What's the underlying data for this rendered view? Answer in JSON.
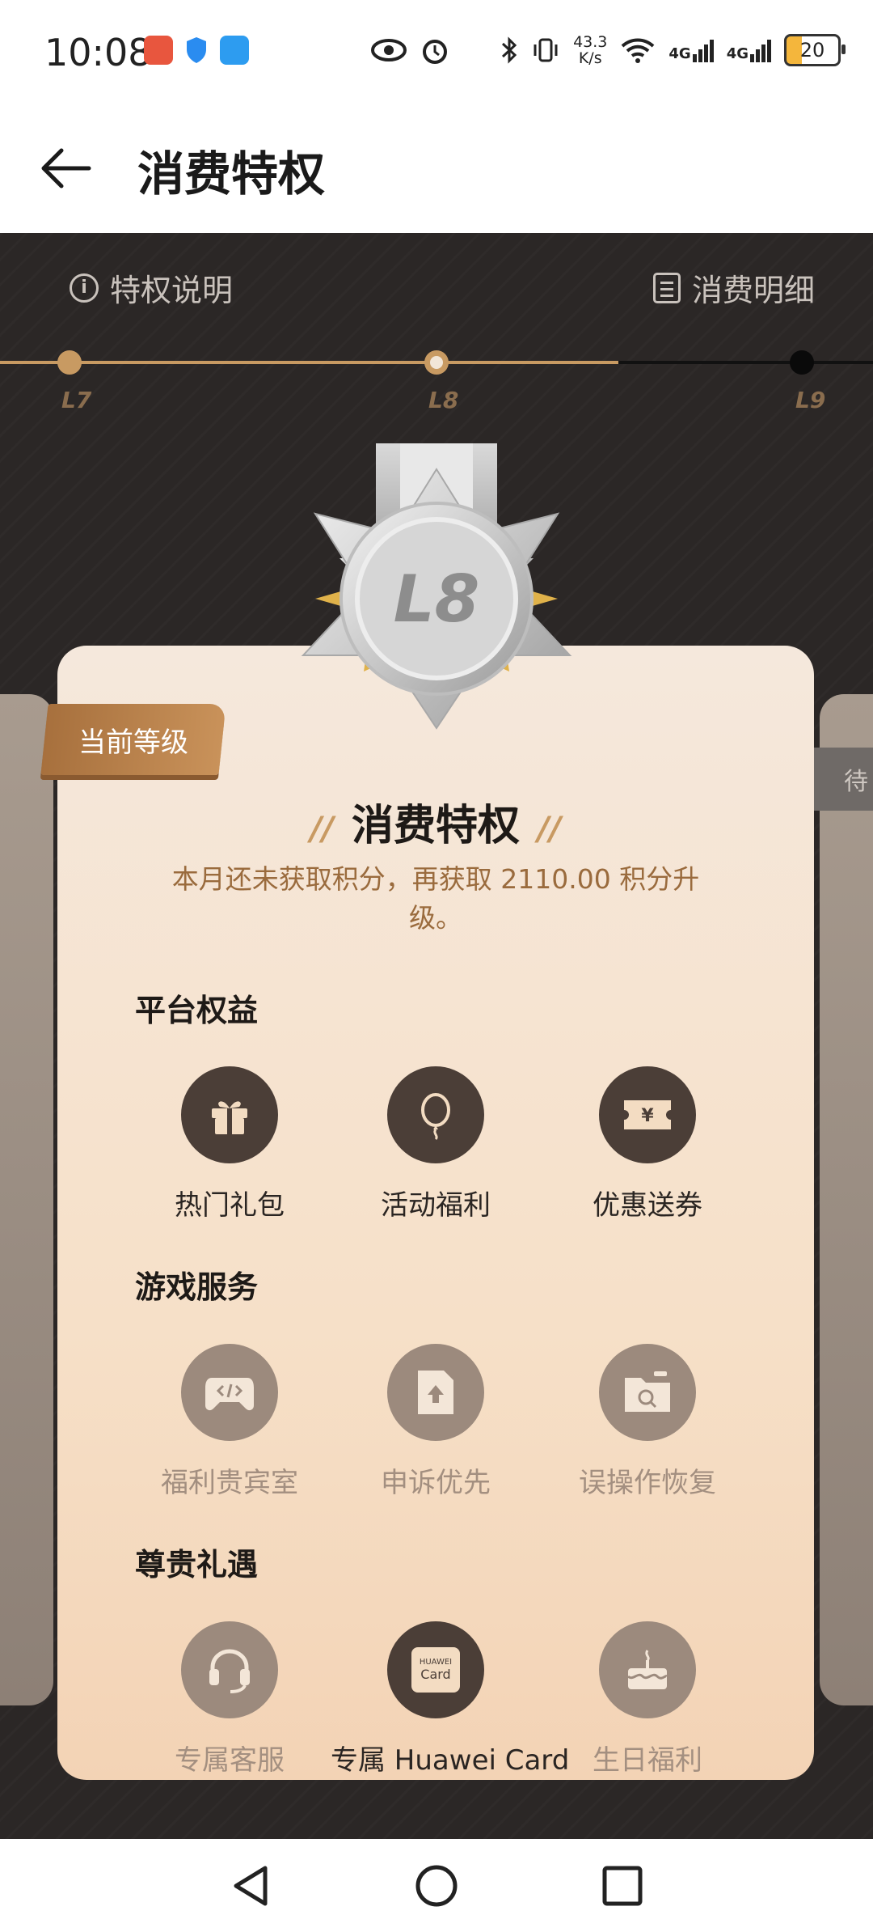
{
  "status_bar": {
    "time": "10:08",
    "net_speed_top": "43.3",
    "net_speed_bottom": "K/s",
    "signal1": "4G",
    "signal2": "4G",
    "battery": "20"
  },
  "header": {
    "title": "消费特权"
  },
  "hero": {
    "privilege_info": "特权说明",
    "consumption_detail": "消费明细",
    "levels": [
      "L7",
      "L8",
      "L9"
    ],
    "side_tag": "待"
  },
  "card": {
    "current_badge": "当前等级",
    "medal_level": "L8",
    "title": "消费特权",
    "subtitle": "本月还未获取积分，再获取 2110.00 积分升级。",
    "sections": [
      {
        "title": "平台权益",
        "items": [
          {
            "label": "热门礼包",
            "icon": "gift-icon"
          },
          {
            "label": "活动福利",
            "icon": "balloon-icon"
          },
          {
            "label": "优惠送券",
            "icon": "coupon-icon"
          }
        ]
      },
      {
        "title": "游戏服务",
        "items": [
          {
            "label": "福利贵宾室",
            "icon": "gamepad-icon"
          },
          {
            "label": "申诉优先",
            "icon": "upload-file-icon"
          },
          {
            "label": "误操作恢复",
            "icon": "restore-icon"
          }
        ]
      },
      {
        "title": "尊贵礼遇",
        "items": [
          {
            "label": "专属客服",
            "icon": "headset-icon"
          },
          {
            "label": "专属 Huawei Card",
            "icon": "huawei-card-icon"
          },
          {
            "label": "生日福利",
            "icon": "birthday-cake-icon"
          }
        ]
      }
    ],
    "huawei_card_text_top": "HUAWEI",
    "huawei_card_text_bottom": "Card"
  },
  "colors": {
    "gold": "#c89a62",
    "hero_bg": "#2b2726",
    "icon_dark": "#4b3e37",
    "icon_muted": "#9c8a7d"
  }
}
